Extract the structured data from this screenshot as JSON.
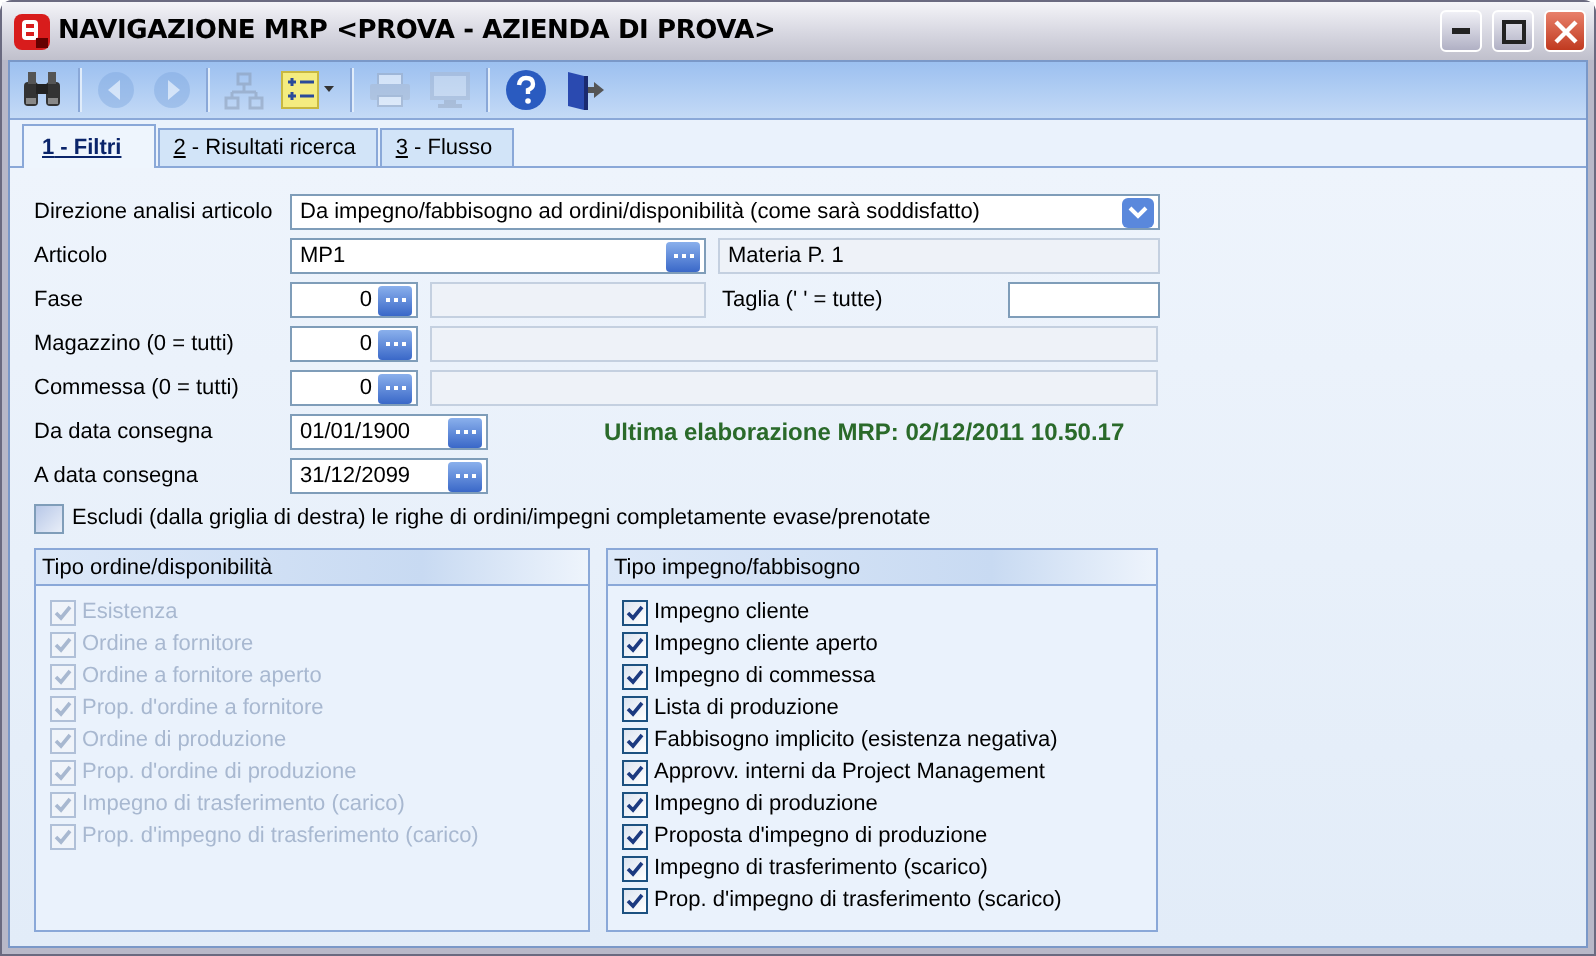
{
  "window": {
    "title": "NAVIGAZIONE MRP <PROVA - AZIENDA DI PROVA>"
  },
  "toolbar": [
    {
      "kind": "search",
      "disabled": false
    },
    {
      "kind": "separator"
    },
    {
      "kind": "back",
      "disabled": true
    },
    {
      "kind": "forward",
      "disabled": true
    },
    {
      "kind": "separator"
    },
    {
      "kind": "hierarchy",
      "disabled": true
    },
    {
      "kind": "list",
      "disabled": false
    },
    {
      "kind": "separator"
    },
    {
      "kind": "print",
      "disabled": true
    },
    {
      "kind": "monitor",
      "disabled": true
    },
    {
      "kind": "separator"
    },
    {
      "kind": "help",
      "disabled": false
    },
    {
      "kind": "exit",
      "disabled": false
    }
  ],
  "tabs": [
    {
      "label": "1 - Filtri",
      "selected": true
    },
    {
      "label": "2 - Risultati ricerca",
      "selected": false
    },
    {
      "label": "3 - Flusso",
      "selected": false
    }
  ],
  "filters": {
    "direction": {
      "label": "Direzione analisi articolo",
      "value": "Da impegno/fabbisogno ad ordini/disponibilità (come sarà soddisfatto)"
    },
    "article": {
      "label": "Articolo",
      "value": "MP1",
      "description": "Materia P. 1"
    },
    "phase": {
      "label": "Fase",
      "value": "0",
      "size_label": "Taglia (' ' = tutte)"
    },
    "warehouse": {
      "label": "Magazzino (0 = tutti)",
      "value": "0"
    },
    "job": {
      "label": "Commessa (0 = tutti)",
      "value": "0"
    },
    "from_date": {
      "label": "Da data consegna",
      "value": "01/01/1900"
    },
    "to_date": {
      "label": "A data consegna",
      "value": "31/12/2099"
    },
    "last_run": "Ultima elaborazione MRP: 02/12/2011 10.50.17",
    "exclude": {
      "label": "Escludi (dalla griglia di destra) le righe di ordini/impegni completamente evase/prenotate",
      "checked": false
    }
  },
  "groups": [
    {
      "title": "Tipo ordine/disponibilità",
      "disabled": true,
      "items": [
        {
          "label": "Esistenza",
          "checked": true
        },
        {
          "label": "Ordine a fornitore",
          "checked": true
        },
        {
          "label": "Ordine a fornitore aperto",
          "checked": true
        },
        {
          "label": "Prop. d'ordine a fornitore",
          "checked": true
        },
        {
          "label": "Ordine di produzione",
          "checked": true
        },
        {
          "label": "Prop. d'ordine di produzione",
          "checked": true
        },
        {
          "label": "Impegno di trasferimento (carico)",
          "checked": true
        },
        {
          "label": "Prop. d'impegno di trasferimento (carico)",
          "checked": true
        }
      ]
    },
    {
      "title": "Tipo impegno/fabbisogno",
      "disabled": false,
      "items": [
        {
          "label": "Impegno cliente",
          "checked": true
        },
        {
          "label": "Impegno cliente aperto",
          "checked": true
        },
        {
          "label": "Impegno di commessa",
          "checked": true
        },
        {
          "label": "Lista di produzione",
          "checked": true
        },
        {
          "label": "Fabbisogno implicito (esistenza negativa)",
          "checked": true
        },
        {
          "label": "Approvv. interni da Project Management",
          "checked": true
        },
        {
          "label": "Impegno di produzione",
          "checked": true
        },
        {
          "label": "Proposta d'impegno di produzione",
          "checked": true
        },
        {
          "label": "Impegno di trasferimento (scarico)",
          "checked": true
        },
        {
          "label": "Prop. d'impegno di trasferimento (scarico)",
          "checked": true
        }
      ]
    }
  ]
}
